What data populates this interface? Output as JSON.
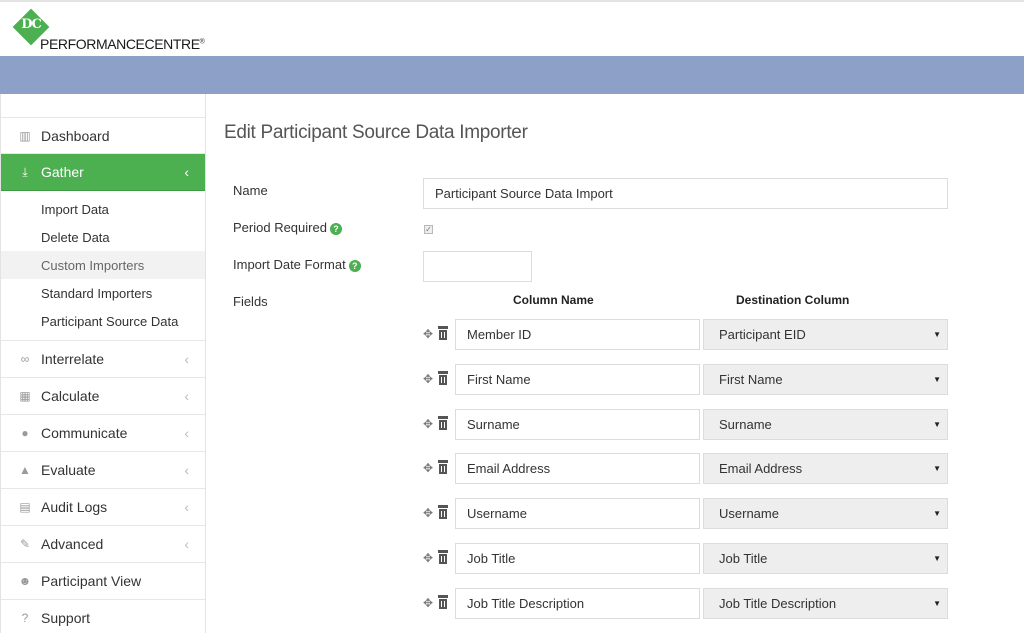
{
  "brand": {
    "monogram": "DC",
    "name": "PERFORMANCECENTRE",
    "reg": "®"
  },
  "sidebar": {
    "items": [
      {
        "label": "Dashboard",
        "icon": "bar-chart-icon"
      },
      {
        "label": "Gather",
        "icon": "download-icon",
        "active": true,
        "children": [
          "Import Data",
          "Delete Data",
          "Custom Importers",
          "Standard Importers",
          "Participant Source Data"
        ]
      },
      {
        "label": "Interrelate",
        "icon": "link-icon"
      },
      {
        "label": "Calculate",
        "icon": "table-icon"
      },
      {
        "label": "Communicate",
        "icon": "comments-icon"
      },
      {
        "label": "Evaluate",
        "icon": "thumbs-up-icon"
      },
      {
        "label": "Audit Logs",
        "icon": "file-icon"
      },
      {
        "label": "Advanced",
        "icon": "wrench-icon"
      },
      {
        "label": "Participant View",
        "icon": "user-icon"
      },
      {
        "label": "Support",
        "icon": "question-icon"
      }
    ],
    "current_child": "Custom Importers"
  },
  "page": {
    "title": "Edit Participant Source Data Importer",
    "labels": {
      "name": "Name",
      "period_required": "Period Required",
      "import_date_format": "Import Date Format",
      "fields": "Fields"
    },
    "name_value": "Participant Source Data Import",
    "period_required_checked": true,
    "import_date_format_value": "",
    "columns": {
      "column_name": "Column Name",
      "destination_column": "Destination Column"
    },
    "fields": [
      {
        "column": "Member ID",
        "destination": "Participant EID"
      },
      {
        "column": "First Name",
        "destination": "First Name"
      },
      {
        "column": "Surname",
        "destination": "Surname"
      },
      {
        "column": "Email Address",
        "destination": "Email Address"
      },
      {
        "column": "Username",
        "destination": "Username"
      },
      {
        "column": "Job Title",
        "destination": "Job Title"
      },
      {
        "column": "Job Title Description",
        "destination": "Job Title Description"
      }
    ]
  },
  "colors": {
    "accent_green": "#4caf50",
    "banner_blue": "#8da0c7"
  }
}
